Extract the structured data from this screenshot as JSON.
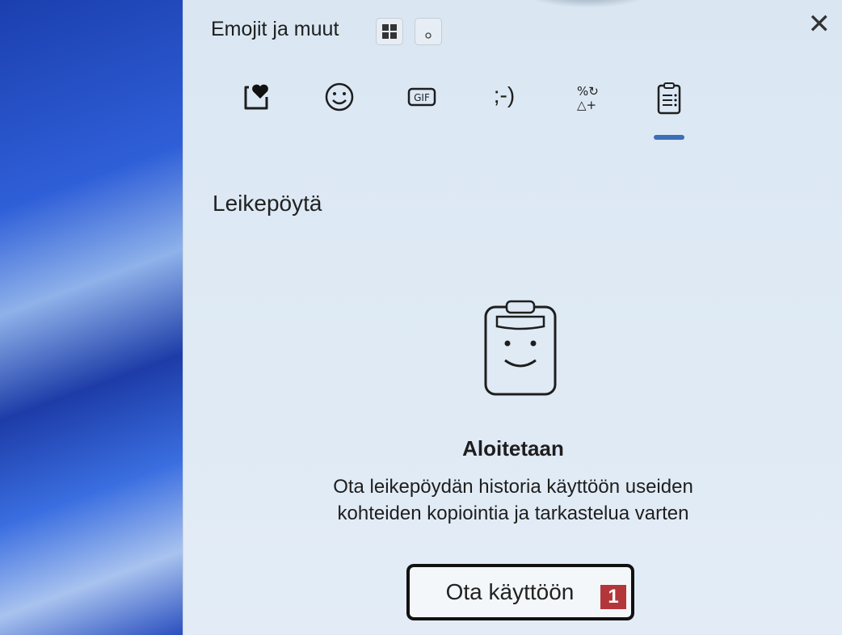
{
  "header": {
    "title": "Emojit ja muut"
  },
  "tabs": [
    {
      "name": "favorites",
      "glyph": "♥"
    },
    {
      "name": "emoji",
      "glyph": "☺"
    },
    {
      "name": "gif",
      "glyph": "GIF"
    },
    {
      "name": "kaomoji",
      "glyph": ";-)"
    },
    {
      "name": "symbols",
      "glyph": "%↻ △+"
    },
    {
      "name": "clipboard",
      "glyph": "📋"
    }
  ],
  "section": {
    "title": "Leikepöytä"
  },
  "empty_state": {
    "heading": "Aloitetaan",
    "line1": "Ota leikepöydän historia käyttöön useiden",
    "line2": "kohteiden kopiointia ja tarkastelua varten"
  },
  "button": {
    "label": "Ota käyttöön",
    "badge": "1"
  },
  "colors": {
    "accent": "#3c6fb8",
    "badge": "#b3363a"
  }
}
